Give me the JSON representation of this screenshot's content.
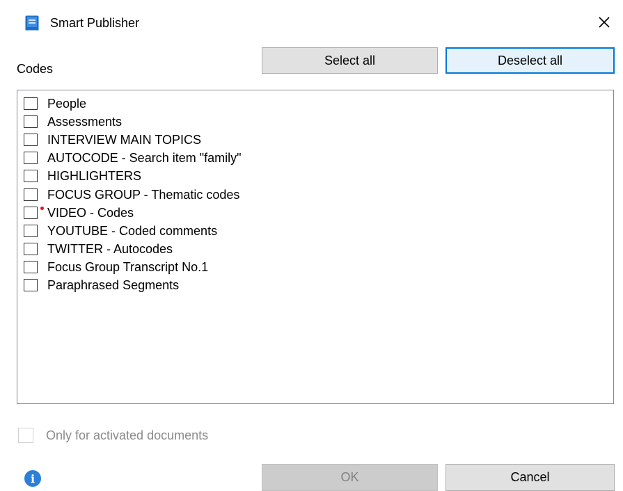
{
  "window": {
    "title": "Smart Publisher",
    "icon": "book-icon",
    "close_icon": "close-icon"
  },
  "codes": {
    "label": "Codes",
    "select_all_label": "Select all",
    "deselect_all_label": "Deselect all",
    "items": [
      {
        "label": "People",
        "checked": false
      },
      {
        "label": "Assessments",
        "checked": false
      },
      {
        "label": "INTERVIEW MAIN TOPICS",
        "checked": false
      },
      {
        "label": "AUTOCODE - Search item \"family\"",
        "checked": false
      },
      {
        "label": "HIGHLIGHTERS",
        "checked": false
      },
      {
        "label": "FOCUS GROUP - Thematic codes",
        "checked": false
      },
      {
        "label": "VIDEO - Codes",
        "checked": false,
        "marker_color": "#e81123"
      },
      {
        "label": "YOUTUBE - Coded comments",
        "checked": false
      },
      {
        "label": "TWITTER - Autocodes",
        "checked": false
      },
      {
        "label": "Focus Group Transcript No.1",
        "checked": false
      },
      {
        "label": "Paraphrased Segments",
        "checked": false
      }
    ]
  },
  "options": {
    "activated_label": "Only for activated documents",
    "activated_checked": false,
    "activated_enabled": false
  },
  "footer": {
    "info_icon": "info-icon",
    "ok_label": "OK",
    "ok_enabled": false,
    "cancel_label": "Cancel"
  },
  "colors": {
    "accent": "#0078d7",
    "info": "#2b7fd7",
    "marker": "#e81123"
  }
}
